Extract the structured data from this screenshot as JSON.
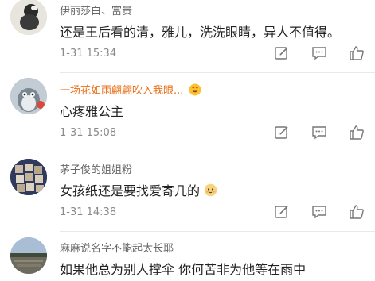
{
  "comments": [
    {
      "name": "伊丽莎白、富贵",
      "text": "还是王后看的清，雅儿，洗洗眼睛，异人不值得。",
      "time": "1-31 15:34",
      "name_color": "#666666"
    },
    {
      "name": "一场花如雨翩翩吹入我眼...",
      "text": "心疼雅公主",
      "time": "1-31 15:08",
      "name_color": "#e8701a",
      "badge_icon": "heart-eyes-emoji-icon"
    },
    {
      "name": "茅子俊的姐姐粉",
      "text": "女孩纸还是要找爱寄几的",
      "time": "1-31 14:38",
      "name_color": "#666666",
      "text_emoji_icon": "cute-face-emoji-icon"
    },
    {
      "name": "麻麻说名字不能起太长耶",
      "text": "如果他总为别人撑伞  你何苦非为他等在雨中",
      "name_color": "#666666"
    }
  ],
  "actions": [
    {
      "name": "edit-icon"
    },
    {
      "name": "comment-icon"
    },
    {
      "name": "like-icon"
    }
  ]
}
